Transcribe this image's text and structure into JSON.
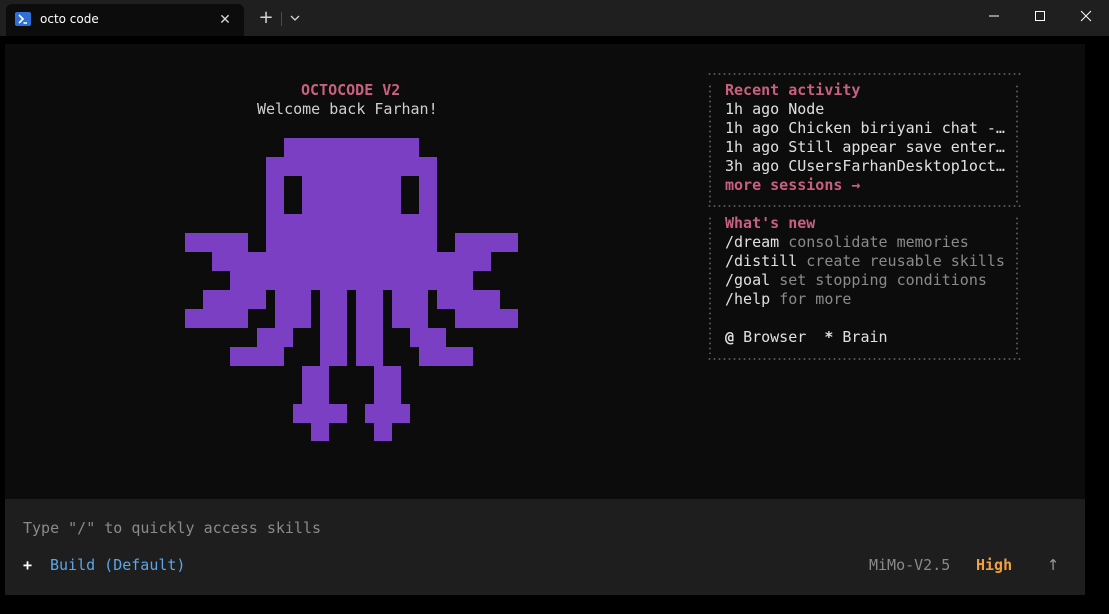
{
  "window": {
    "tab_title": "octo code",
    "tab_close": "✕",
    "new_tab": "+"
  },
  "colors": {
    "accent_pink": "#c8607f",
    "octopus_purple": "#7b3fc4",
    "build_blue": "#5aa6e8",
    "effort_orange": "#f0a040"
  },
  "banner": {
    "title": "OCTOCODE V2",
    "welcome": "Welcome back Farhan!"
  },
  "recent": {
    "heading": "Recent activity",
    "items": [
      {
        "time": "1h ago",
        "name": "Node"
      },
      {
        "time": "1h ago",
        "name": "Chicken biriyani chat -…"
      },
      {
        "time": "1h ago",
        "name": "Still appear save enter…"
      },
      {
        "time": "3h ago",
        "name": "CUsersFarhanDesktop1oct…"
      }
    ],
    "more": "more sessions →"
  },
  "whats_new": {
    "heading": "What's new",
    "items": [
      {
        "command": "/dream",
        "desc": "consolidate memories"
      },
      {
        "command": "/distill",
        "desc": "create reusable skills"
      },
      {
        "command": "/goal",
        "desc": "set stopping conditions"
      },
      {
        "command": "/help",
        "desc": "for more"
      }
    ]
  },
  "status": {
    "browser_symbol": "@",
    "browser_label": "Browser",
    "brain_symbol": "*",
    "brain_label": "Brain"
  },
  "input": {
    "placeholder": "Type \"/\" to quickly access skills",
    "plus": "+",
    "agent": "Build (Default)",
    "model": "MiMo-V2.5",
    "effort": "High",
    "send": "↑"
  }
}
